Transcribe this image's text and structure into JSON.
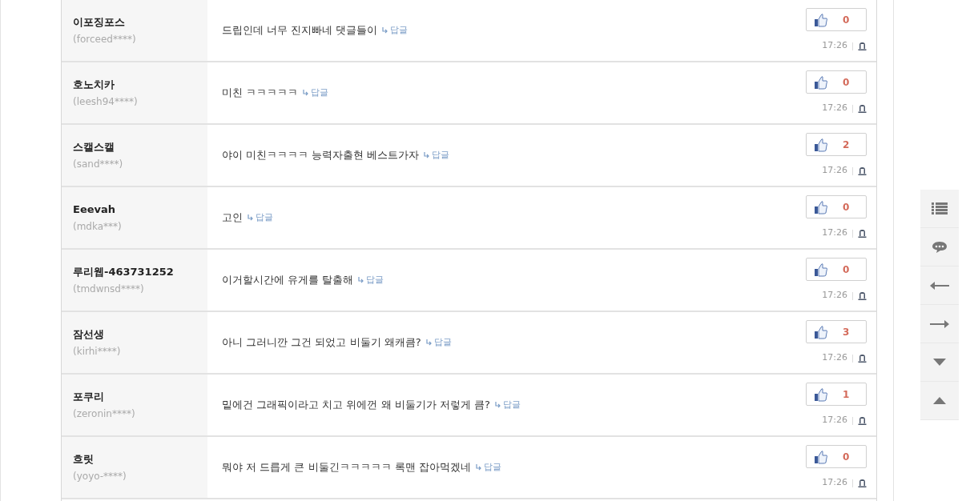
{
  "comments": [
    {
      "nickname": "이포징포스",
      "user_id": "(forceed****)",
      "text": "드립인데 너무 진지빠네 댓글들이",
      "reply": "답글",
      "likes": "0",
      "time": "17:26"
    },
    {
      "nickname": "호노치카",
      "user_id": "(leesh94****)",
      "text": "미친 ㅋㅋㅋㅋㅋ",
      "reply": "답글",
      "likes": "0",
      "time": "17:26"
    },
    {
      "nickname": "스캘스캘",
      "user_id": "(sand****)",
      "text": "야이 미친ㅋㅋㅋㅋ 능력자출현 베스트가자",
      "reply": "답글",
      "likes": "2",
      "time": "17:26"
    },
    {
      "nickname": "Eeevah",
      "user_id": "(mdka***)",
      "text": "고인",
      "reply": "답글",
      "likes": "0",
      "time": "17:26"
    },
    {
      "nickname": "루리웹-463731252",
      "user_id": "(tmdwnsd****)",
      "text": "이거할시간에 유게를 탈출해",
      "reply": "답글",
      "likes": "0",
      "time": "17:26"
    },
    {
      "nickname": "잠선생",
      "user_id": "(kirhi****)",
      "text": "아니 그러니깐 그건 되었고 비둘기 왜캐큼?",
      "reply": "답글",
      "likes": "3",
      "time": "17:26"
    },
    {
      "nickname": "포쿠리",
      "user_id": "(zeronin****)",
      "text": "밑에건 그래픽이라고 치고 위에껀 왜 비둘기가 저렇게 큼?",
      "reply": "답글",
      "likes": "1",
      "time": "17:26"
    },
    {
      "nickname": "흐릿",
      "user_id": "(yoyo-****)",
      "text": "뭐야 저 드릅게 큰 비둘긴ㅋㅋㅋㅋㅋ 록맨 잡아먹겠네",
      "reply": "답글",
      "likes": "0",
      "time": "17:26"
    }
  ],
  "side_buttons": [
    {
      "kind": "list"
    },
    {
      "kind": "comment"
    },
    {
      "kind": "left"
    },
    {
      "kind": "right"
    },
    {
      "kind": "down"
    },
    {
      "kind": "up"
    }
  ]
}
